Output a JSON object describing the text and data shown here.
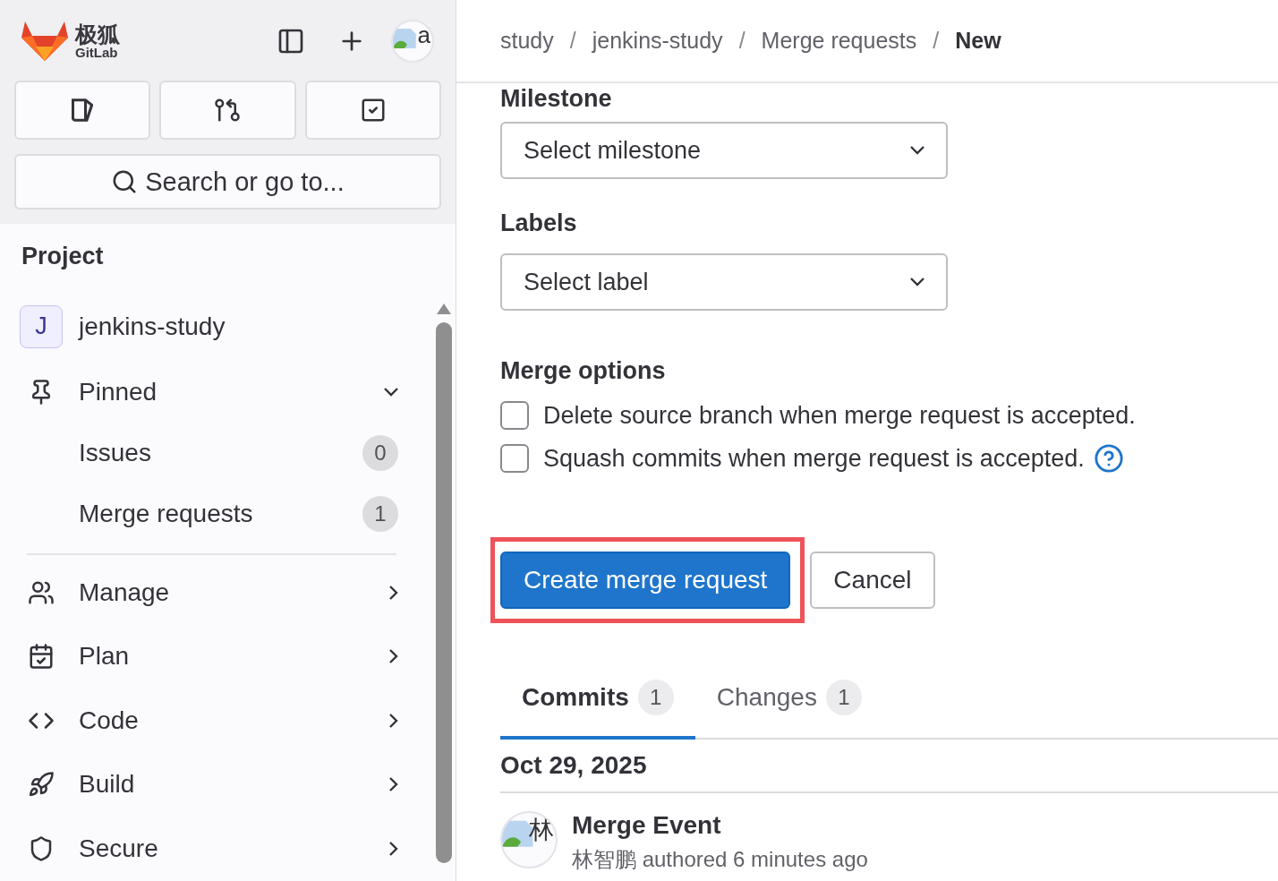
{
  "sidebar": {
    "logo": {
      "cn": "极狐",
      "en": "GitLab"
    },
    "avatar_alt": "a",
    "search": {
      "placeholder": "Search or go to..."
    },
    "section_title": "Project",
    "project": {
      "initial": "J",
      "name": "jenkins-study"
    },
    "items": [
      {
        "label": "Pinned",
        "kind": "group",
        "expanded": true,
        "children": [
          {
            "label": "Issues",
            "count": "0"
          },
          {
            "label": "Merge requests",
            "count": "1"
          }
        ]
      },
      {
        "label": "Manage",
        "kind": "menu",
        "expanded": false
      },
      {
        "label": "Plan",
        "kind": "menu",
        "expanded": false
      },
      {
        "label": "Code",
        "kind": "menu",
        "expanded": false
      },
      {
        "label": "Build",
        "kind": "menu",
        "expanded": false
      },
      {
        "label": "Secure",
        "kind": "menu",
        "expanded": false
      }
    ]
  },
  "breadcrumbs": [
    {
      "label": "study"
    },
    {
      "separator": "/",
      "label": "jenkins-study"
    },
    {
      "separator": "/",
      "label": "Merge requests"
    },
    {
      "separator": "/",
      "label": "New"
    }
  ],
  "form": {
    "milestone": {
      "label": "Milestone",
      "value": "Select milestone"
    },
    "labels": {
      "label": "Labels",
      "value": "Select label"
    },
    "merge_options": {
      "title": "Merge options",
      "options": [
        {
          "label": "Delete source branch when merge request is accepted.",
          "checked": false,
          "help": false
        },
        {
          "label": "Squash commits when merge request is accepted.",
          "checked": false,
          "help": true
        }
      ]
    },
    "submit": "Create merge request",
    "cancel": "Cancel"
  },
  "tabs": [
    {
      "label": "Commits",
      "count": "1",
      "selected": true
    },
    {
      "label": "Changes",
      "count": "1",
      "selected": false
    }
  ],
  "commits": {
    "date": "Oct 29, 2025",
    "items": [
      {
        "avatar_alt": "林",
        "title": "Merge Event",
        "author": "林智鹏",
        "meta": "authored 6 minutes ago"
      }
    ]
  }
}
